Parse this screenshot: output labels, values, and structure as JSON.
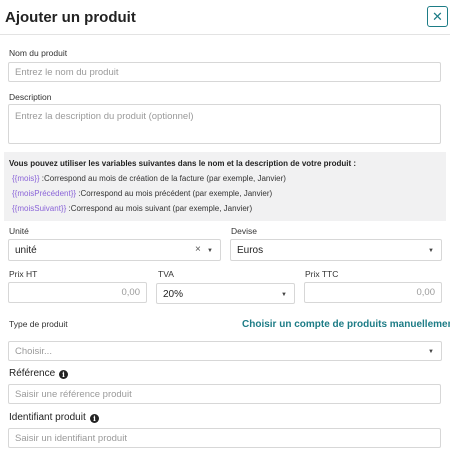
{
  "modal": {
    "title": "Ajouter un produit",
    "close_icon": "close-icon"
  },
  "fields": {
    "name": {
      "label": "Nom du produit",
      "placeholder": "Entrez le nom du produit"
    },
    "description": {
      "label": "Description",
      "placeholder": "Entrez la description du produit (optionnel)"
    }
  },
  "variables": {
    "title": "Vous pouvez utiliser les variables suivantes dans le nom et la description de votre produit :",
    "items": [
      {
        "tag": "{{mois}}",
        "text": " :Correspond au mois de création de la facture (par exemple, Janvier)"
      },
      {
        "tag": "{{moisPrécédent}}",
        "text": " :Correspond au mois précédent (par exemple, Janvier)"
      },
      {
        "tag": "{{moisSuivant}}",
        "text": " :Correspond au mois suivant (par exemple, Janvier)"
      }
    ]
  },
  "unit": {
    "label": "Unité",
    "value": "unité",
    "clear": "×",
    "caret": "▼"
  },
  "currency": {
    "label": "Devise",
    "value": "Euros",
    "caret": "▼"
  },
  "price_ht": {
    "label": "Prix HT",
    "placeholder": "0,00"
  },
  "tva": {
    "label": "TVA",
    "value": "20%",
    "caret": "▼"
  },
  "price_ttc": {
    "label": "Prix TTC",
    "placeholder": "0,00"
  },
  "product_type": {
    "label": "Type de produit",
    "link": "Choisir un compte de produits manuellement",
    "placeholder": "Choisir...",
    "caret": "▼"
  },
  "reference": {
    "label": "Référence",
    "placeholder": "Saisir une référence produit",
    "info": "i"
  },
  "identifier": {
    "label": "Identifiant produit",
    "placeholder": "Saisir un identifiant produit",
    "info": "i"
  }
}
